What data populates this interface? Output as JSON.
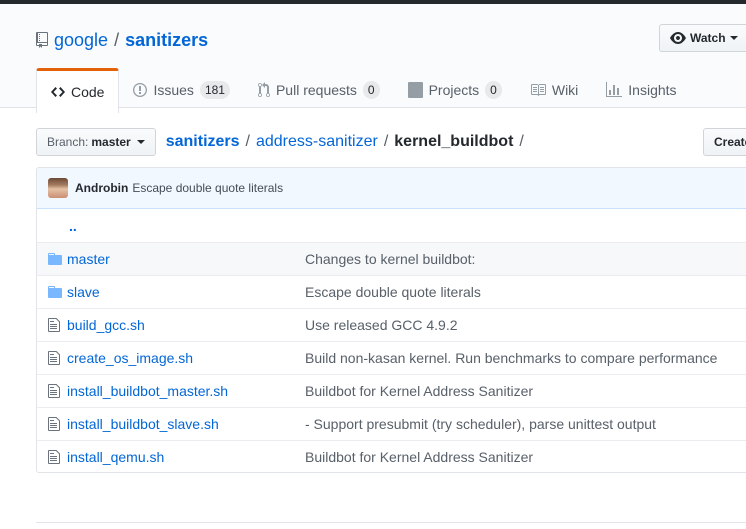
{
  "repo": {
    "owner": "google",
    "separator": "/",
    "name": "sanitizers"
  },
  "watch": {
    "label": "Watch"
  },
  "tabs": [
    {
      "label": "Code",
      "icon": "code-icon"
    },
    {
      "label": "Issues",
      "count": "181",
      "icon": "issue-icon"
    },
    {
      "label": "Pull requests",
      "count": "0",
      "icon": "pull-request-icon"
    },
    {
      "label": "Projects",
      "count": "0",
      "icon": "project-icon"
    },
    {
      "label": "Wiki",
      "icon": "book-icon"
    },
    {
      "label": "Insights",
      "icon": "graph-icon"
    }
  ],
  "branch": {
    "label": "Branch:",
    "value": "master"
  },
  "breadcrumb": {
    "root": "sanitizers",
    "sep": "/",
    "dir1": "address-sanitizer",
    "current": "kernel_buildbot"
  },
  "create_button": {
    "label": "Create"
  },
  "commit": {
    "author": "Androbin",
    "message": "Escape double quote literals"
  },
  "parent_link": "..",
  "files": [
    {
      "type": "dir",
      "name": "master",
      "message": "Changes to kernel buildbot:"
    },
    {
      "type": "dir",
      "name": "slave",
      "message": "Escape double quote literals"
    },
    {
      "type": "file",
      "name": "build_gcc.sh",
      "message": "Use released GCC 4.9.2"
    },
    {
      "type": "file",
      "name": "create_os_image.sh",
      "message": "Build non-kasan kernel. Run benchmarks to compare performance"
    },
    {
      "type": "file",
      "name": "install_buildbot_master.sh",
      "message": "Buildbot for Kernel Address Sanitizer"
    },
    {
      "type": "file",
      "name": "install_buildbot_slave.sh",
      "message": "- Support presubmit (try scheduler), parse unittest output"
    },
    {
      "type": "file",
      "name": "install_qemu.sh",
      "message": "Buildbot for Kernel Address Sanitizer"
    }
  ],
  "colors": {
    "link": "#0366d6",
    "tab_accent": "#e36209",
    "commit_bg": "#f1f8ff",
    "folder": "#79b8ff"
  }
}
